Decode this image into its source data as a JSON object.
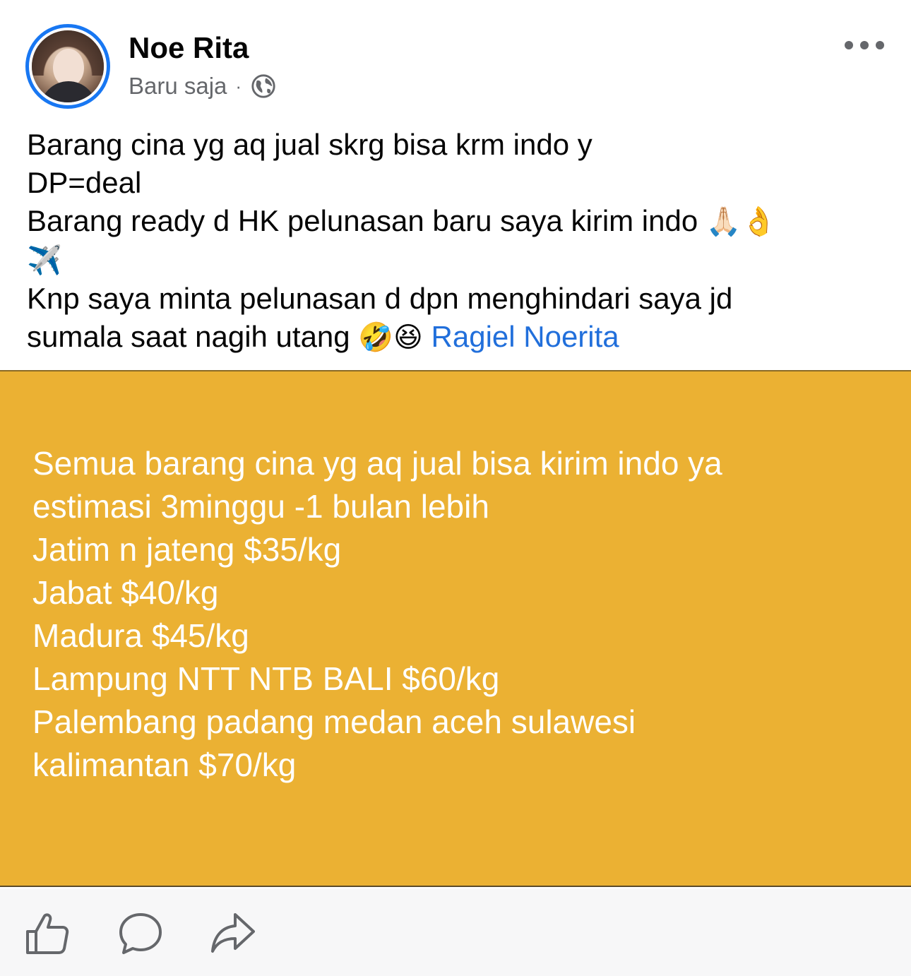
{
  "post": {
    "author": "Noe Rita",
    "timestamp": "Baru saja",
    "separator": "·",
    "privacy_icon": "globe-icon",
    "text_lines": [
      "Barang cina yg aq jual skrg bisa krm indo y",
      "DP=deal",
      "Barang ready d HK pelunasan baru saya kirim indo",
      "Knp saya minta pelunasan d dpn menghindari saya jd",
      "sumala saat nagih utang"
    ],
    "emojis": {
      "pray": "🙏🏻",
      "ok_hand": "👌",
      "airplane": "✈️",
      "rofl": "🤣",
      "laughing": "😆"
    },
    "mention": "Ragiel Noerita"
  },
  "card": {
    "background": "#ebb133",
    "lines": [
      "Semua barang cina yg aq jual bisa kirim indo  ya",
      "estimasi 3minggu -1 bulan lebih",
      "Jatim n jateng $35/kg",
      "Jabat $40/kg",
      "Madura $45/kg",
      "Lampung NTT NTB BALI $60/kg",
      "Palembang padang medan aceh sulawesi",
      "kalimantan $70/kg"
    ]
  },
  "actions": {
    "like_icon": "thumbs-up-icon",
    "comment_icon": "comment-icon",
    "share_icon": "share-icon"
  },
  "colors": {
    "accent": "#1877f2",
    "mention": "#216fdb",
    "secondary_text": "#65676b"
  }
}
